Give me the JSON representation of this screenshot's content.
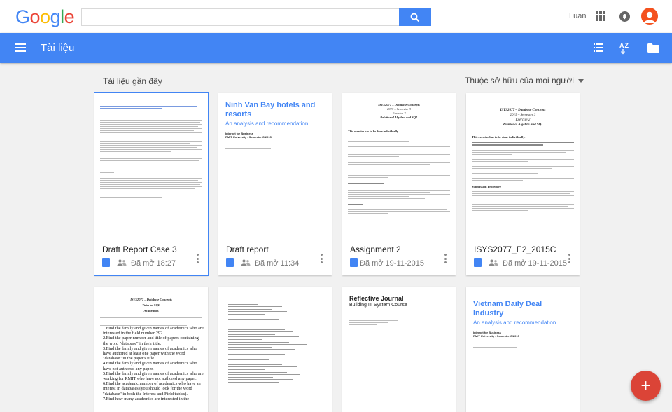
{
  "header": {
    "logo_letters": [
      "G",
      "o",
      "o",
      "g",
      "l",
      "e"
    ],
    "search": {
      "value": "",
      "placeholder": ""
    },
    "user_name": "Luan"
  },
  "appbar": {
    "title": "Tài liệu",
    "sort_icon_label": "AZ"
  },
  "section": {
    "title": "Tài liệu gần đây",
    "owner_filter": "Thuộc sở hữu của mọi người"
  },
  "documents": [
    {
      "title": "Draft Report Case 3",
      "opened": "Đã mở 18:27",
      "shared": true,
      "selected": true
    },
    {
      "title": "Draft report",
      "opened": "Đã mở 11:34",
      "shared": true,
      "selected": false,
      "thumb": {
        "heading": "Ninh Van Bay hotels and resorts",
        "subheading": "An analysis and recommendation",
        "line1": "Internet for Business",
        "line2": "RMIT University - Semester C/2015"
      }
    },
    {
      "title": "Assignment 2",
      "opened": "Đã mở 19-11-2015",
      "shared": false,
      "selected": false,
      "thumb": {
        "h1": "ISYS2077 – Database Concepts",
        "h2": "2015 – Semester 3",
        "h3": "Exercise 2",
        "h4": "Relational Algebra and SQL",
        "lead": "This exercise has to be done individually."
      }
    },
    {
      "title": "ISYS2077_E2_2015C",
      "opened": "Đã mở 19-11-2015",
      "shared": true,
      "selected": false,
      "thumb": {
        "h1": "ISYS2077 – Database Concepts",
        "h2": "2015 – Semester 3",
        "h3": "Exercise 2",
        "h4": "Relational Algebra and SQL",
        "lead": "This exercise has to be done individually.",
        "section": "Submission Procedure"
      }
    },
    {
      "thumb": {
        "h1": "ISYS2077 – Database Concepts",
        "h2": "Tutorial SQL",
        "h3": "Academics",
        "items": [
          "1.Find the family and given names of academics who are interested in the field number 292.",
          "2.Find the paper number and title of papers containing the word \"database\" in their title.",
          "3.Find the family and given names of academics who have authored at least one paper with the word \"database\" in the paper's title.",
          "4.Find the family and given names of academics who have not authored any paper.",
          "5.Find the family and given names of academics who are working for RMIT who have not authored any paper.",
          "6.Find the academic number of academics who have an interest in databases (you should look for the word \"database\" in both the Interest and Field tables).",
          "7.Find how many academics are interested in the"
        ]
      }
    },
    {
      "thumb": {
        "kind": "code"
      }
    },
    {
      "thumb": {
        "heading": "Reflective Journal",
        "subheading": "Building IT System Course"
      }
    },
    {
      "thumb": {
        "heading": "Vietnam Daily Deal Industry",
        "subheading": "An analysis and recommendation",
        "line1": "Internet for Business",
        "line2": "RMIT University - Semester C/2015"
      }
    }
  ],
  "fab": {
    "label": "+"
  },
  "colors": {
    "accent": "#4285f4",
    "fab": "#db4437",
    "avatar": "#f4511e",
    "background": "#f1f1f1"
  }
}
